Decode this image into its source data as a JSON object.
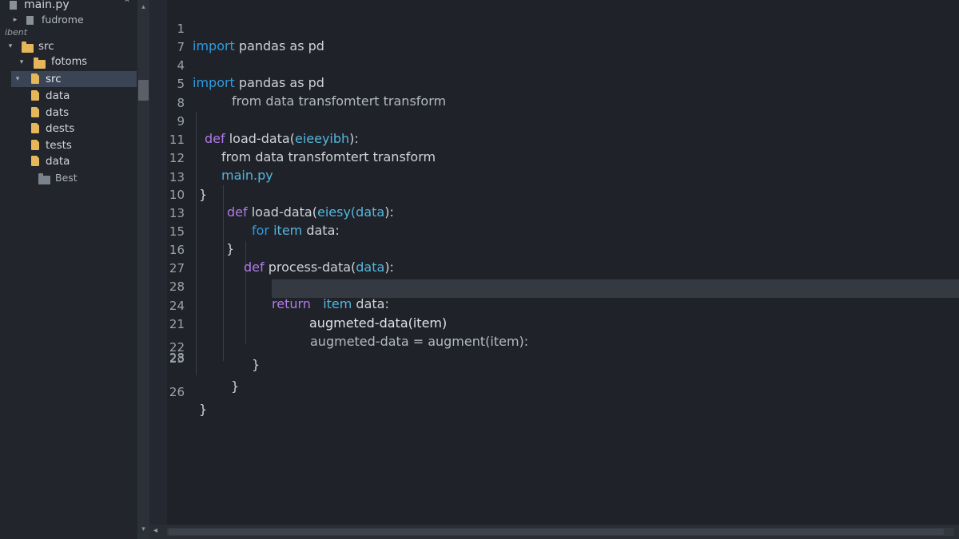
{
  "sidebar": {
    "title": "main.py",
    "items": [
      {
        "label": "fudrome"
      },
      {
        "label": "ibent"
      },
      {
        "label": "src"
      },
      {
        "label": "fotoms"
      },
      {
        "label": "src"
      },
      {
        "label": "data"
      },
      {
        "label": "dats"
      },
      {
        "label": "dests"
      },
      {
        "label": "tests"
      },
      {
        "label": "data"
      },
      {
        "label": "Best"
      }
    ]
  },
  "editor": {
    "lines": [
      {
        "n": "1",
        "kw1": "import",
        "t1": " pandas as pd"
      },
      {
        "n": "7"
      },
      {
        "n": "4",
        "kw1": "import",
        "t1": " pandas as pd"
      },
      {
        "n": "5",
        "t1": "from data transfomtert transform"
      },
      {
        "n": "8"
      },
      {
        "n": "9",
        "kw1": "def",
        "t1": " load-data(",
        "p1": "eieeyibh",
        "t2": "):"
      },
      {
        "n": "11",
        "t1": "from data transfomtert transform"
      },
      {
        "n": "12",
        "p1": "main.py"
      },
      {
        "n": "13",
        "t1": "}"
      },
      {
        "n": "10",
        "kw1": "def",
        "t1": " load-data(",
        "p1": "eiesy(data",
        "t2": "):"
      },
      {
        "n": "13",
        "kw1": "for",
        "t1": " ",
        "p1": "item",
        "t2": " data:"
      },
      {
        "n": "15",
        "t1": "}"
      },
      {
        "n": "16",
        "kw1": "def",
        "t1": " process-data(",
        "p1": "data",
        "t2": "):"
      },
      {
        "n": "27"
      },
      {
        "n": "28",
        "kw2": "return",
        "t1": "   ",
        "p1": "item",
        "t2": " data:"
      },
      {
        "n": "24",
        "t1": "augmeted-data(item)"
      },
      {
        "n": "21",
        "t1": "augmeted-data = augment(item):"
      },
      {
        "n": "22",
        "t1": "}"
      },
      {
        "n": "28",
        "t1": "}"
      },
      {
        "n": "23",
        "t1": "}"
      },
      {
        "n": "26",
        "t1": "}"
      }
    ]
  }
}
